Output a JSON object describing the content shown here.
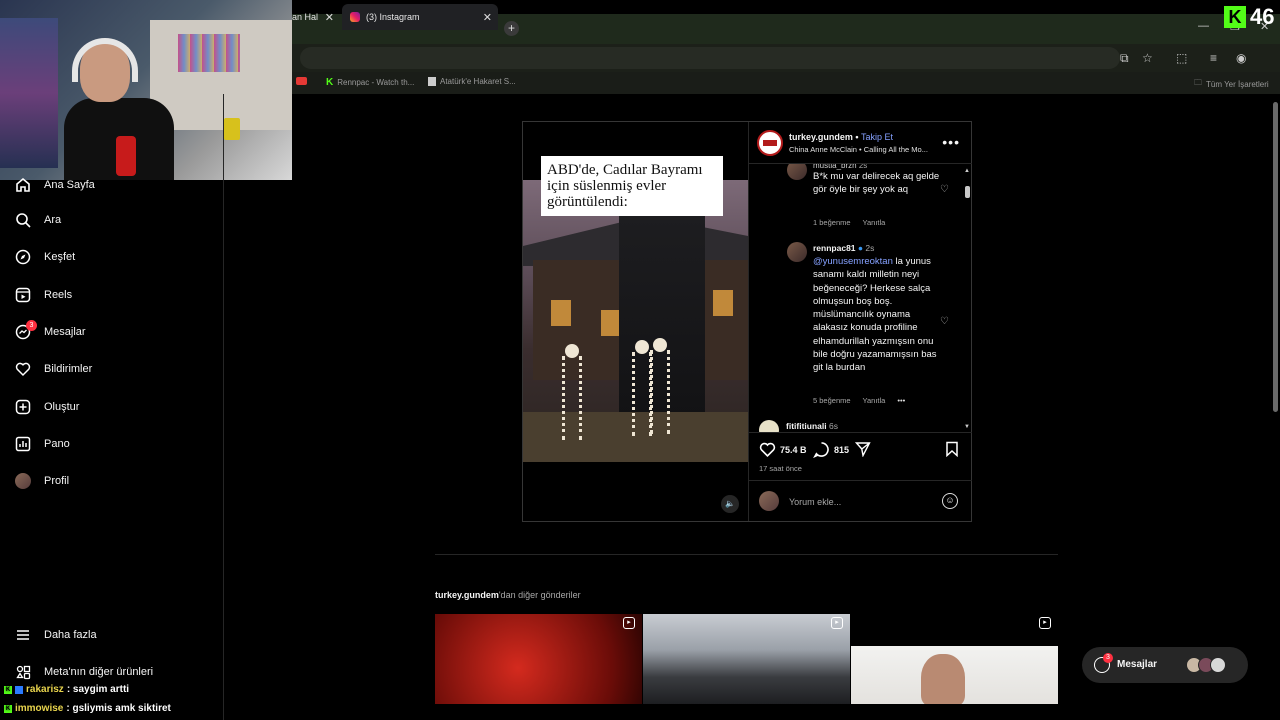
{
  "browser": {
    "tabs": [
      {
        "label": "an Hal"
      },
      {
        "label": "(3) Instagram"
      }
    ],
    "bookmarks": [
      {
        "label": "Rennpac - Watch th..."
      },
      {
        "label": "Atatürk'e Hakaret S..."
      },
      {
        "label": "Tüm Yer İşaretleri"
      }
    ]
  },
  "kick": {
    "viewer_count": "46"
  },
  "sidebar": {
    "items": [
      {
        "label": "Ana Sayfa"
      },
      {
        "label": "Ara"
      },
      {
        "label": "Keşfet"
      },
      {
        "label": "Reels"
      },
      {
        "label": "Mesajlar"
      },
      {
        "label": "Bildirimler"
      },
      {
        "label": "Oluştur"
      },
      {
        "label": "Pano"
      },
      {
        "label": "Profil"
      },
      {
        "label": "Daha fazla"
      },
      {
        "label": "Meta'nın diğer ürünleri"
      }
    ],
    "messages_badge": "3"
  },
  "chat": [
    {
      "user": "rakarisz",
      "message": ": saygim artti"
    },
    {
      "user": "immowise",
      "message": ": gsliymis amk siktiret"
    }
  ],
  "post": {
    "caption": "ABD'de, Cadılar Bayramı için süslenmiş evler görüntülendi:",
    "username": "turkey.gundem",
    "follow_label": "Takip Et",
    "audio": "China Anne McClain • Calling All the Mo...",
    "comments": [
      {
        "user": "mustia_brzn",
        "time": "2s",
        "text": "B*k mu var delirecek aq gelde gör öyle bir şey yok aq",
        "likes": "1 beğenme",
        "reply": "Yanıtla"
      },
      {
        "user": "rennpac81",
        "time": "2s",
        "mention": "@yunusemreoktan",
        "text": " la yunus sanamı kaldı milletin neyi beğeneceği? Herkese salça olmuşsun boş boş. müslümancılık oynama alakasız konuda profiline elhamdurillah yazmışsın onu bile doğru yazamamışsın bas git la burdan",
        "likes": "5 beğenme",
        "reply": "Yanıtla"
      },
      {
        "user": "fitifitiunali",
        "time": "6s"
      }
    ],
    "likes": "75.4 B",
    "comments_count": "815",
    "posted": "17 saat önce",
    "comment_placeholder": "Yorum ekle..."
  },
  "more_posts": {
    "username": "turkey.gundem",
    "suffix": "'dan diğer gönderiler"
  },
  "messages_pill": {
    "label": "Mesajlar",
    "count": "3"
  }
}
